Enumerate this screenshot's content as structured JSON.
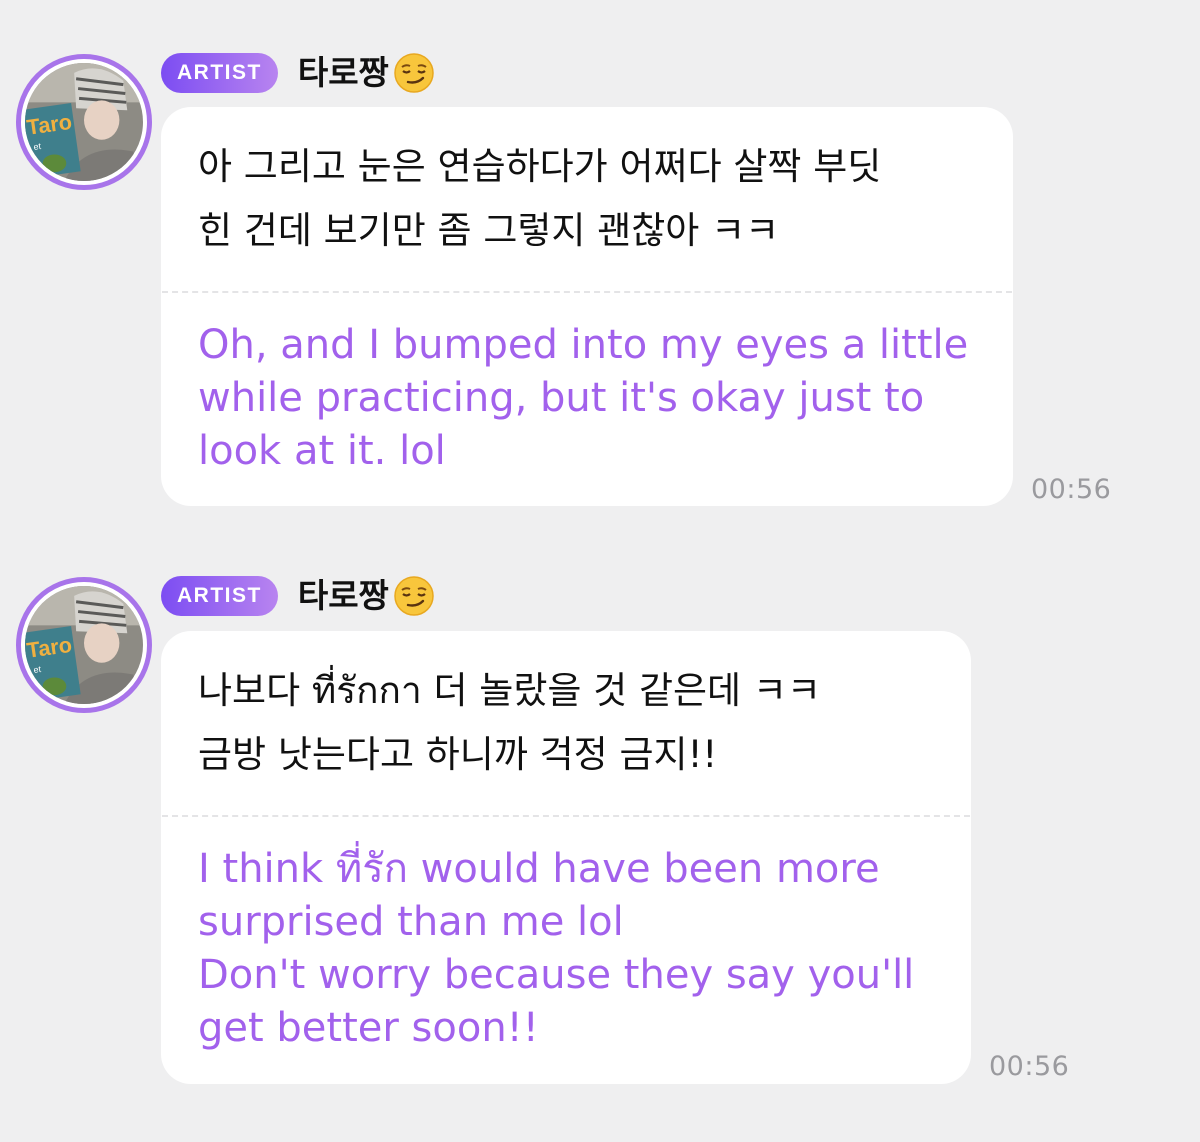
{
  "messages": [
    {
      "badge": "ARTIST",
      "sender": "타로짱",
      "sender_emoji": "smirking-face-emoji",
      "original": "아 그리고 눈은 연습하다가 어쩌다 살짝 부딧\n힌 건데 보기만 좀 그렇지 괜찮아 ㅋㅋ",
      "translation": "Oh, and I bumped into my eyes a little\nwhile practicing, but it's okay just to\nlook at it. lol",
      "time": "00:56"
    },
    {
      "badge": "ARTIST",
      "sender": "타로짱",
      "sender_emoji": "smirking-face-emoji",
      "original": "나보다 ที่รักกา 더 놀랐을 것 같은데 ㅋㅋ\n금방 낫는다고 하니까 걱정 금지!!",
      "translation": "I think ที่รัก would have been more\nsurprised than me lol\nDon't worry because they say you'll\nget better soon!!",
      "time": "00:56"
    }
  ],
  "colors": {
    "background": "#efeff0",
    "bubble": "#ffffff",
    "translation_text": "#a261ec",
    "badge_start": "#7c4df2",
    "badge_end": "#b884f0",
    "avatar_ring": "#a874ea",
    "timestamp": "#9a9a9e"
  }
}
